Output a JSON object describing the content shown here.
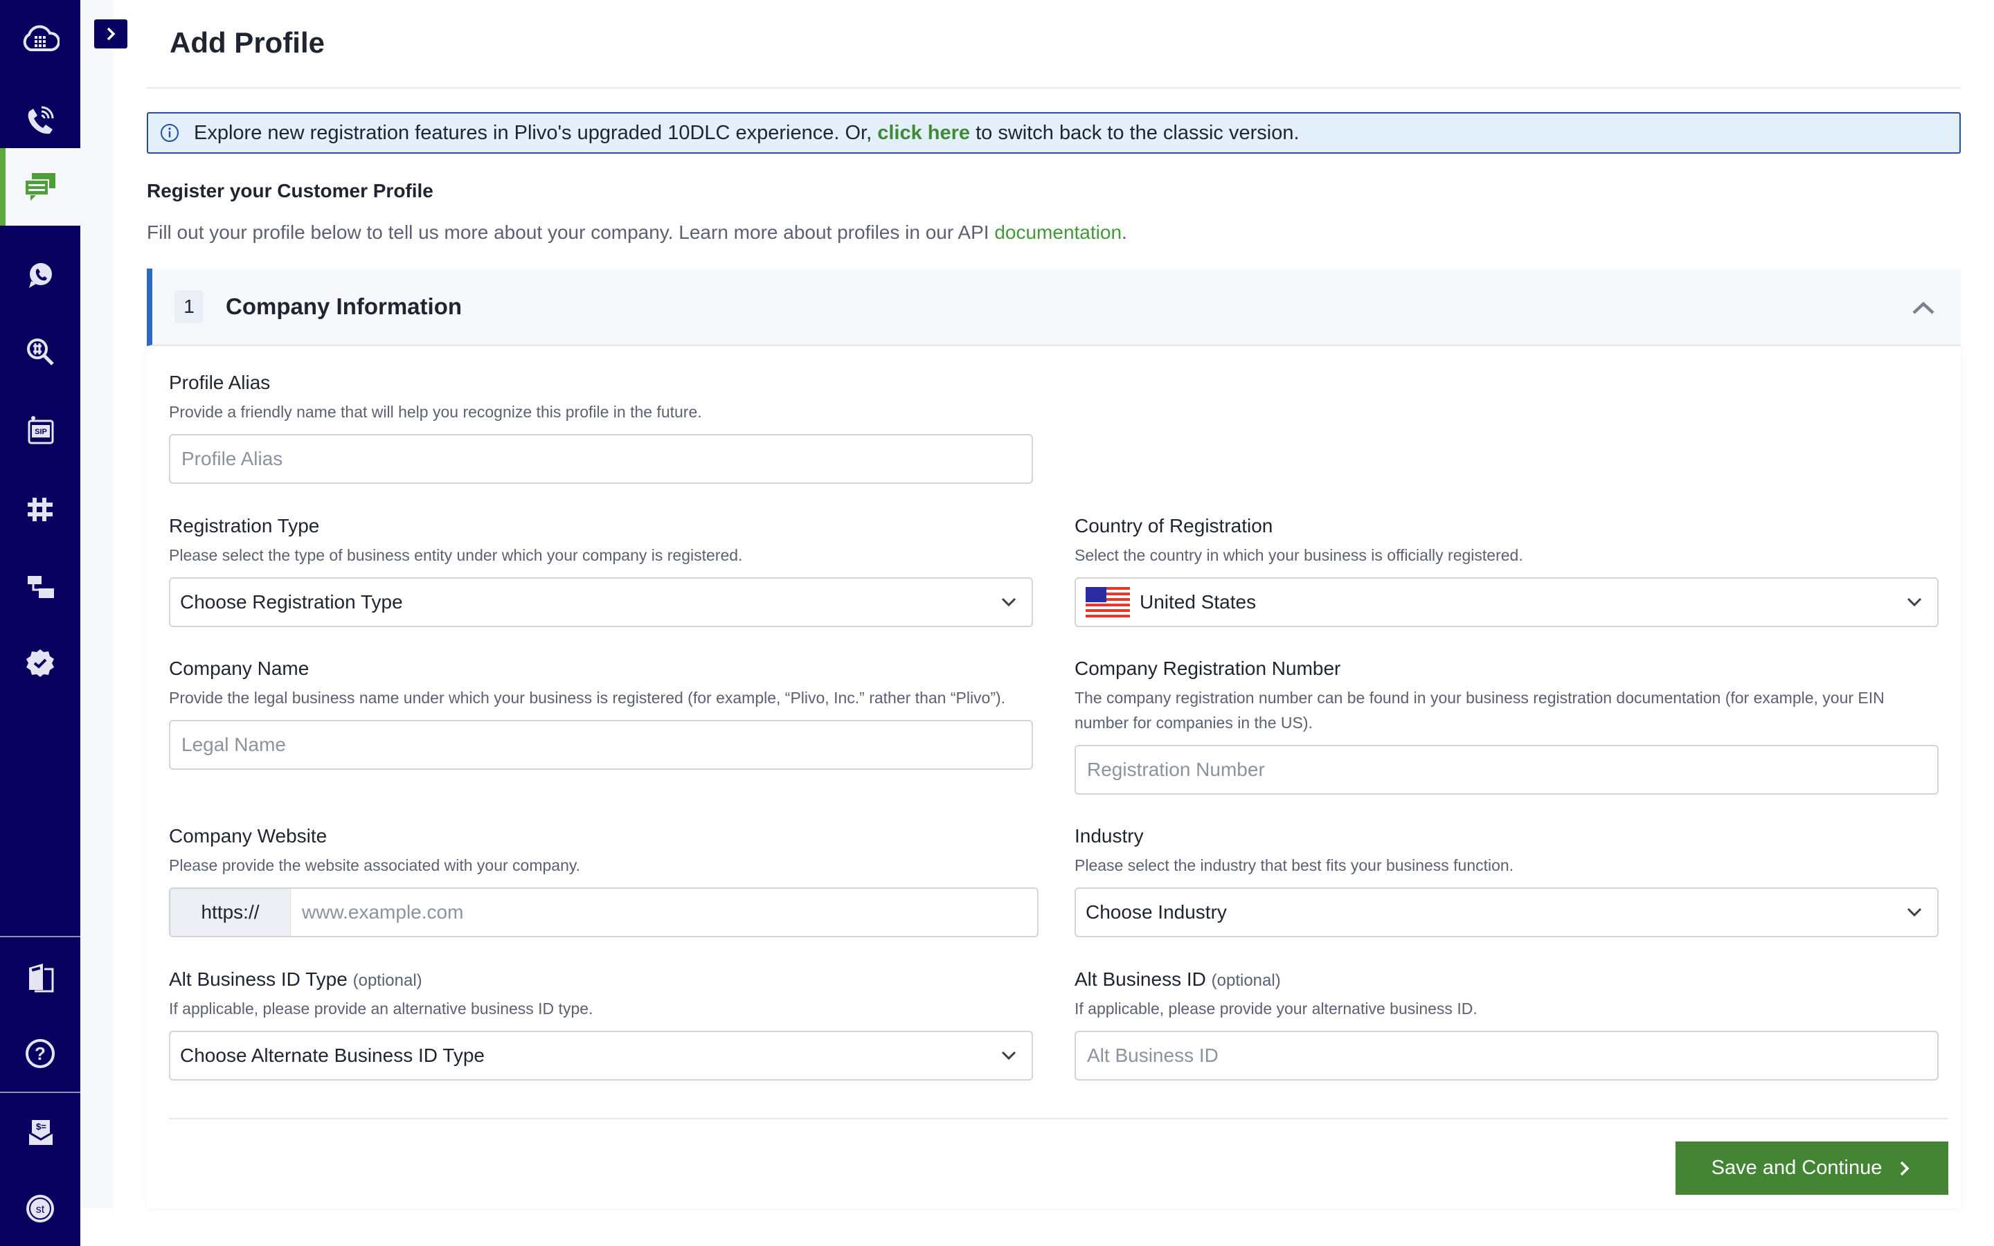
{
  "page": {
    "title": "Add Profile"
  },
  "sidebar": {
    "items": [
      {
        "icon": "cloud-keypad-icon",
        "label": "Dashboard"
      },
      {
        "icon": "phone-call-icon",
        "label": "Voice"
      },
      {
        "icon": "messaging-icon",
        "label": "Messaging",
        "active": true
      },
      {
        "icon": "whatsapp-icon",
        "label": "WhatsApp"
      },
      {
        "icon": "number-lookup-icon",
        "label": "Lookup"
      },
      {
        "icon": "sip-icon",
        "label": "SIP Trunking"
      },
      {
        "icon": "hash-icon",
        "label": "Phone Numbers"
      },
      {
        "icon": "flow-icon",
        "label": "PHLO"
      },
      {
        "icon": "verified-badge-icon",
        "label": "Verify"
      },
      {
        "icon": "docs-icon",
        "label": "Docs"
      },
      {
        "icon": "help-icon",
        "label": "Help"
      },
      {
        "icon": "billing-icon",
        "label": "Billing"
      },
      {
        "icon": "account-avatar-icon",
        "label": "st"
      }
    ],
    "accent_active": "#5aaa3c",
    "bg": "#07005f"
  },
  "banner": {
    "text_before": "Explore new registration features in Plivo's upgraded 10DLC experience. Or, ",
    "link": "click here",
    "text_after": " to switch back to the classic version."
  },
  "intro": {
    "heading": "Register your Customer Profile",
    "desc_before": "Fill out your profile below to tell us more about your company. Learn more about profiles in our API ",
    "desc_link": "documentation",
    "desc_after": "."
  },
  "section": {
    "step": "1",
    "title": "Company Information",
    "expanded": true
  },
  "fields": {
    "profile_alias": {
      "label": "Profile Alias",
      "help": "Provide a friendly name that will help you recognize this profile in the future.",
      "placeholder": "Profile Alias",
      "value": ""
    },
    "registration_type": {
      "label": "Registration Type",
      "help": "Please select the type of business entity under which your company is registered.",
      "selected": "Choose Registration Type"
    },
    "country": {
      "label": "Country of Registration",
      "help": "Select the country in which your business is officially registered.",
      "selected": "United States",
      "flag": "us-flag-icon"
    },
    "company_name": {
      "label": "Company Name",
      "help": "Provide the legal business name under which your business is registered (for example, “Plivo, Inc.” rather than “Plivo”).",
      "placeholder": "Legal Name",
      "value": ""
    },
    "registration_number": {
      "label": "Company Registration Number",
      "help": "The company registration number can be found in your business registration documentation (for example, your EIN number for companies in the US).",
      "placeholder": "Registration Number",
      "value": ""
    },
    "website": {
      "label": "Company Website",
      "help": "Please provide the website associated with your company.",
      "prefix": "https://",
      "placeholder": "www.example.com",
      "value": ""
    },
    "industry": {
      "label": "Industry",
      "help": "Please select the industry that best fits your business function.",
      "selected": "Choose Industry"
    },
    "alt_id_type": {
      "label": "Alt Business ID Type",
      "optional": "(optional)",
      "help": "If applicable, please provide an alternative business ID type.",
      "selected": "Choose Alternate Business ID Type"
    },
    "alt_id": {
      "label": "Alt Business ID",
      "optional": "(optional)",
      "help": "If applicable, please provide your alternative business ID.",
      "placeholder": "Alt Business ID",
      "value": ""
    }
  },
  "actions": {
    "save_continue": "Save and Continue"
  },
  "colors": {
    "primary_green": "#438535",
    "link_green": "#3f8a35",
    "banner_border": "#22509e",
    "banner_bg": "#e3f0fc",
    "accordion_accent": "#2d6ac4"
  }
}
